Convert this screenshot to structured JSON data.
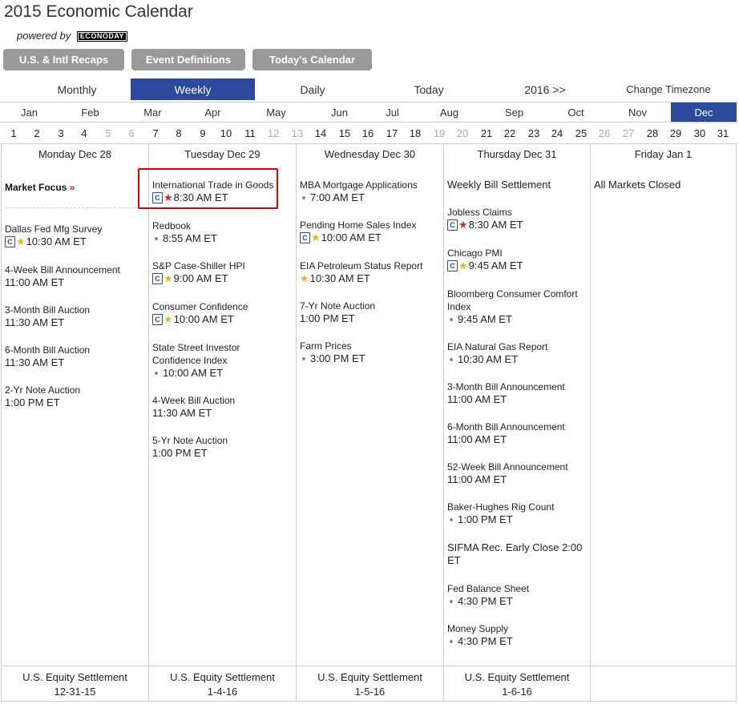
{
  "header": {
    "title": "2015 Economic Calendar",
    "powered_by": "powered by",
    "logo_text": "ECONODAY"
  },
  "buttons": {
    "recaps": "U.S. & Intl Recaps",
    "definitions": "Event Definitions",
    "todays_calendar": "Today's Calendar"
  },
  "views": {
    "monthly": "Monthly",
    "weekly": "Weekly",
    "daily": "Daily",
    "today": "Today",
    "next_year": "2016 >>",
    "change_timezone": "Change Timezone"
  },
  "months": [
    "Jan",
    "Feb",
    "Mar",
    "Apr",
    "May",
    "Jun",
    "Jul",
    "Aug",
    "Sep",
    "Oct",
    "Nov",
    "Dec"
  ],
  "active_month": "Dec",
  "days": [
    "1",
    "2",
    "3",
    "4",
    "5",
    "6",
    "7",
    "8",
    "9",
    "10",
    "11",
    "12",
    "13",
    "14",
    "15",
    "16",
    "17",
    "18",
    "19",
    "20",
    "21",
    "22",
    "23",
    "24",
    "25",
    "26",
    "27",
    "28",
    "29",
    "30",
    "31"
  ],
  "dim_days": [
    "5",
    "6",
    "12",
    "13",
    "19",
    "20",
    "26",
    "27"
  ],
  "columns": {
    "mon": {
      "header": "Monday Dec 28",
      "market_focus": "Market Focus",
      "market_focus_arrow": "»",
      "events": [
        {
          "name": "Dallas Fed Mfg Survey",
          "time": "10:30 AM ET"
        },
        {
          "name": "4-Week Bill Announcement",
          "time": "11:00 AM ET"
        },
        {
          "name": "3-Month Bill Auction",
          "time": "11:30 AM ET"
        },
        {
          "name": "6-Month Bill Auction",
          "time": "11:30 AM ET"
        },
        {
          "name": "2-Yr Note Auction",
          "time": "1:00 PM ET"
        }
      ],
      "footer_line1": "U.S. Equity Settlement",
      "footer_line2": "12-31-15"
    },
    "tue": {
      "header": "Tuesday Dec 29",
      "events": [
        {
          "name": "International Trade in Goods",
          "time": "8:30 AM ET"
        },
        {
          "name": "Redbook",
          "time": "8:55 AM ET"
        },
        {
          "name": "S&P Case-Shiller HPI",
          "time": "9:00 AM ET"
        },
        {
          "name": "Consumer Confidence",
          "time": "10:00 AM ET"
        },
        {
          "name": "State Street Investor",
          "name2": "Confidence Index",
          "time": "10:00 AM ET"
        },
        {
          "name": "4-Week Bill Auction",
          "time": "11:30 AM ET"
        },
        {
          "name": "5-Yr Note Auction",
          "time": "1:00 PM ET"
        }
      ],
      "footer_line1": "U.S. Equity Settlement",
      "footer_line2": "1-4-16"
    },
    "wed": {
      "header": "Wednesday Dec 30",
      "events": [
        {
          "name": "MBA Mortgage Applications",
          "time": "7:00 AM ET"
        },
        {
          "name": "Pending Home Sales Index",
          "time": "10:00 AM ET"
        },
        {
          "name": "EIA Petroleum Status Report",
          "time": "10:30 AM ET"
        },
        {
          "name": "7-Yr Note Auction",
          "time": "1:00 PM ET"
        },
        {
          "name": "Farm Prices",
          "time": "3:00 PM ET"
        }
      ],
      "footer_line1": "U.S. Equity Settlement",
      "footer_line2": "1-5-16"
    },
    "thu": {
      "header": "Thursday Dec 31",
      "events": [
        {
          "name": "Weekly Bill Settlement"
        },
        {
          "name": "Jobless Claims",
          "time": "8:30 AM ET"
        },
        {
          "name": "Chicago PMI",
          "time": "9:45 AM ET"
        },
        {
          "name": "Bloomberg Consumer Comfort",
          "name2": "Index",
          "time": "9:45 AM ET"
        },
        {
          "name": "EIA Natural Gas Report",
          "time": "10:30 AM ET"
        },
        {
          "name": "3-Month Bill Announcement",
          "time": "11:00 AM ET"
        },
        {
          "name": "6-Month Bill Announcement",
          "time": "11:00 AM ET"
        },
        {
          "name": "52-Week Bill Announcement",
          "time": "11:00 AM ET"
        },
        {
          "name": "Baker-Hughes Rig Count",
          "time": "1:00 PM ET"
        },
        {
          "name": "SIFMA Rec. Early Close 2:00",
          "name2": "ET"
        },
        {
          "name": "Fed Balance Sheet",
          "time": "4:30 PM ET"
        },
        {
          "name": "Money Supply",
          "time": "4:30 PM ET"
        }
      ],
      "footer_line1": "U.S. Equity Settlement",
      "footer_line2": "1-6-16"
    },
    "fri": {
      "header": "Friday Jan 1",
      "events": [
        {
          "name": "All Markets Closed"
        }
      ]
    }
  },
  "icons": {
    "consensus": "C",
    "star": "★"
  },
  "colors": {
    "accent": "#2c4a9c",
    "button_gray": "#999999",
    "star_red": "#dd2222",
    "star_gold": "#e8b320",
    "highlight": "#dd0000"
  }
}
